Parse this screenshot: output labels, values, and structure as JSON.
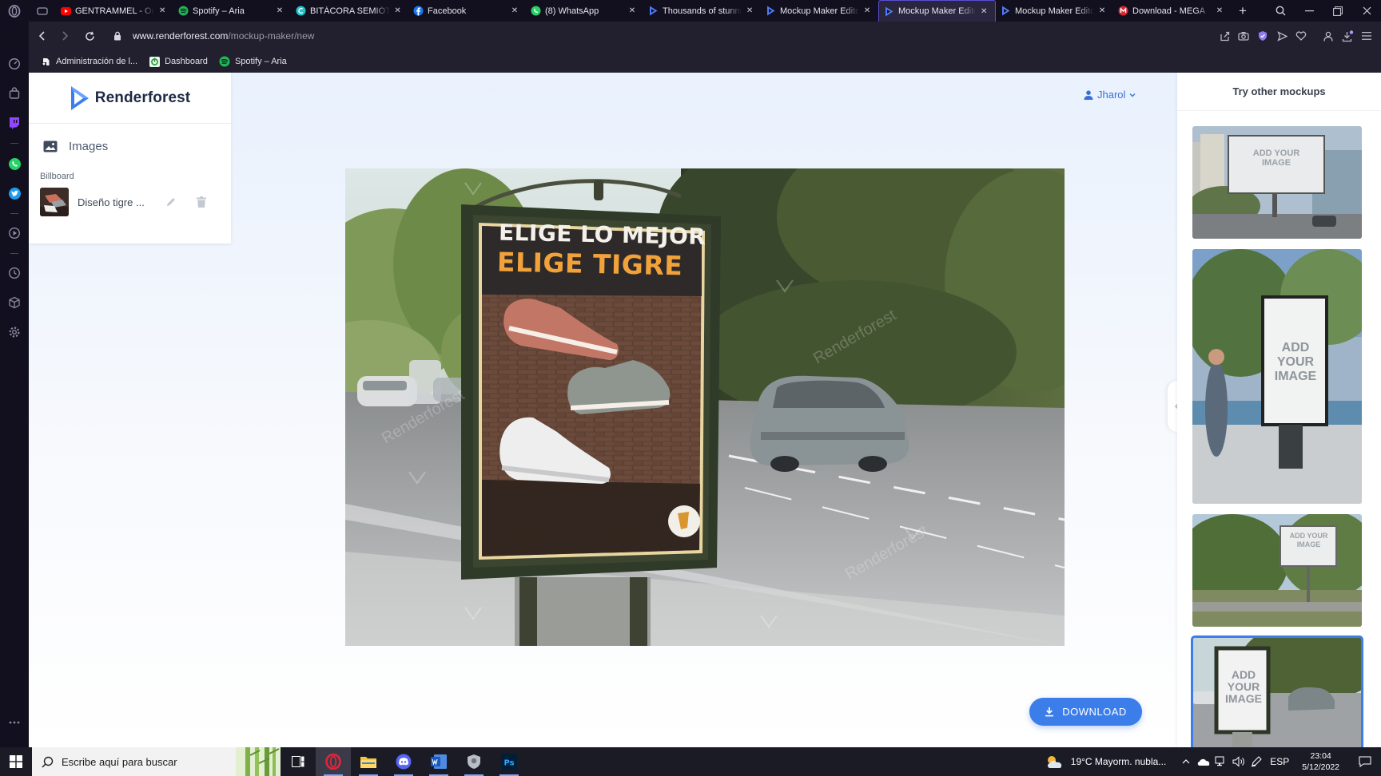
{
  "browser": {
    "tabs": [
      {
        "title": "GENTRAMMEL - Ou",
        "icon": "youtube-icon",
        "color": "#ff0000"
      },
      {
        "title": "Spotify – Aria",
        "icon": "spotify-icon",
        "color": "#1db954"
      },
      {
        "title": "BITÁCORA SEMIÓTIC",
        "icon": "canva-icon",
        "color": "#20c4cb"
      },
      {
        "title": "Facebook",
        "icon": "facebook-icon",
        "color": "#1877f2"
      },
      {
        "title": "(8) WhatsApp",
        "icon": "whatsapp-icon",
        "color": "#25d366"
      },
      {
        "title": "Thousands of stunni",
        "icon": "renderforest-icon",
        "color": "#4e7cf6"
      },
      {
        "title": "Mockup Maker Edito",
        "icon": "renderforest-icon",
        "color": "#4e7cf6"
      },
      {
        "title": "Mockup Maker Edito",
        "icon": "renderforest-icon",
        "color": "#4e7cf6",
        "active": true
      },
      {
        "title": "Mockup Maker Edito",
        "icon": "renderforest-icon",
        "color": "#4e7cf6"
      },
      {
        "title": "Download - MEGA",
        "icon": "mega-icon",
        "color": "#d9272e"
      }
    ],
    "url_host": "www.renderforest.com",
    "url_path": "/mockup-maker/new",
    "bookmarks": [
      {
        "label": "Administración de l...",
        "icon": "bookmark-page-icon"
      },
      {
        "label": "Dashboard",
        "icon": "dashboard-icon"
      },
      {
        "label": "Spotify – Aria",
        "icon": "spotify-icon"
      }
    ]
  },
  "app": {
    "logo_text": "Renderforest",
    "images_label": "Images",
    "billboard_label": "Billboard",
    "design_name": "Diseño tigre ...",
    "user_name": "Jharol",
    "download_label": "DOWNLOAD",
    "right_panel_title": "Try other mockups",
    "mockup_thumb_text": "ADD YOUR IMAGE",
    "poster": {
      "line1": "ELIGE LO MEJOR",
      "line2": "ELIGE TIGRE"
    },
    "watermark": "Renderforest"
  },
  "taskbar": {
    "search_placeholder": "Escribe aquí para buscar",
    "weather": "19°C  Mayorm. nubla...",
    "lang": "ESP",
    "time": "23:04",
    "date": "5/12/2022"
  },
  "colors": {
    "accent": "#3b7de9",
    "browser_bg": "#12101e",
    "poster_bg": "#46372d",
    "poster_text_white": "#f4f1ea",
    "poster_text_orange": "#f2a23a"
  }
}
